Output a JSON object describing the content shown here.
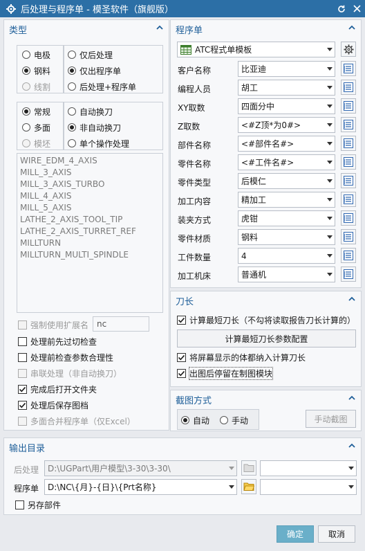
{
  "window": {
    "title": "后处理与程序单 - 模圣软件（旗舰版）"
  },
  "type_section": {
    "title": "类型",
    "machine_radios": [
      {
        "label": "电极",
        "checked": false,
        "disabled": false
      },
      {
        "label": "钢料",
        "checked": true,
        "disabled": false
      },
      {
        "label": "线割",
        "checked": false,
        "disabled": true
      }
    ],
    "output_radios": [
      {
        "label": "仅后处理",
        "checked": false
      },
      {
        "label": "仅出程序单",
        "checked": true
      },
      {
        "label": "后处理+程序单",
        "checked": false
      }
    ],
    "face_radios": [
      {
        "label": "常规",
        "checked": true,
        "disabled": false
      },
      {
        "label": "多面",
        "checked": false,
        "disabled": false
      },
      {
        "label": "模坯",
        "checked": false,
        "disabled": true
      }
    ],
    "tool_radios": [
      {
        "label": "自动换刀",
        "checked": false
      },
      {
        "label": "非自动换刀",
        "checked": true
      },
      {
        "label": "单个操作处理",
        "checked": false
      }
    ],
    "postprocessors": [
      "WIRE_EDM_4_AXIS",
      "MILL_3_AXIS",
      "MILL_3_AXIS_TURBO",
      "MILL_4_AXIS",
      "MILL_5_AXIS",
      "LATHE_2_AXIS_TOOL_TIP",
      "LATHE_2_AXIS_TURRET_REF",
      "MILLTURN",
      "MILLTURN_MULTI_SPINDLE"
    ],
    "force_ext_label": "强制使用扩展名",
    "force_ext_value": "nc",
    "options": [
      {
        "label": "处理前先过切检查",
        "checked": false,
        "disabled": false
      },
      {
        "label": "处理前检查参数合理性",
        "checked": false,
        "disabled": false
      },
      {
        "label": "串联处理（非自动换刀）",
        "checked": false,
        "disabled": true
      },
      {
        "label": "完成后打开文件夹",
        "checked": true,
        "disabled": false
      },
      {
        "label": "处理后保存图档",
        "checked": true,
        "disabled": false
      },
      {
        "label": "多面合并程序单（仅Excel）",
        "checked": false,
        "disabled": true
      }
    ]
  },
  "program_sheet": {
    "title": "程序单",
    "template": "ATC程式单模板",
    "fields": [
      {
        "label": "客户名称",
        "value": "比亚迪"
      },
      {
        "label": "编程人员",
        "value": "胡工"
      },
      {
        "label": "XY取数",
        "value": "四面分中"
      },
      {
        "label": "Z取数",
        "value": "<#Z顶*为0#>"
      },
      {
        "label": "部件名称",
        "value": "<#部件名#>"
      },
      {
        "label": "零件名称",
        "value": "<#工件名#>"
      },
      {
        "label": "零件类型",
        "value": "后模仁"
      },
      {
        "label": "加工内容",
        "value": "精加工"
      },
      {
        "label": "装夹方式",
        "value": "虎钳"
      },
      {
        "label": "零件材质",
        "value": "钢料"
      },
      {
        "label": "工件数量",
        "value": "4"
      },
      {
        "label": "加工机床",
        "value": "普通机"
      }
    ]
  },
  "tool_length": {
    "title": "刀长",
    "calc_shortest": {
      "label": "计算最短刀长（不勾将读取报告刀长计算的）",
      "checked": true
    },
    "config_button": "计算最短刀长参数配置",
    "include_bodies": {
      "label": "将屏幕显示的体都纳入计算刀长",
      "checked": true
    },
    "stay_in_drafting": {
      "label": "出图后停留在制图模块",
      "checked": true
    }
  },
  "screenshot": {
    "title": "截图方式",
    "options": [
      {
        "label": "自动",
        "checked": true
      },
      {
        "label": "手动",
        "checked": false
      }
    ],
    "manual_button": "手动截图"
  },
  "output_dir": {
    "title": "输出目录",
    "post_label": "后处理",
    "post_path": "D:\\UGPart\\用户模型\\3-30\\3-30\\",
    "program_label": "程序单",
    "program_path": "D:\\NC\\{月}-{日}\\{Prt名称}",
    "save_part_label": "另存部件",
    "save_part_checked": false
  },
  "footer": {
    "ok": "确定",
    "cancel": "取消"
  },
  "colors": {
    "titlebar": "#2c6fa6",
    "section_title": "#1f5f99",
    "ok_button": "#6aafc9"
  }
}
